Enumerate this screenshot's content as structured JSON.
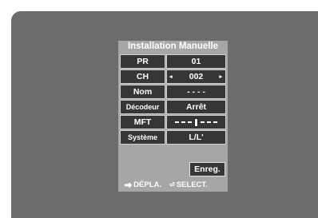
{
  "title": "Installation Manuelle",
  "rows": [
    {
      "label": "PR",
      "value": "01"
    },
    {
      "label": "CH",
      "value": "002"
    },
    {
      "label": "Nom",
      "value": "- - - -"
    },
    {
      "label": "Décodeur",
      "value": "Arrêt"
    },
    {
      "label": "MFT",
      "value": ""
    },
    {
      "label": "Système",
      "value": "L/L'"
    }
  ],
  "arrows": {
    "left": "◂",
    "right": "▸"
  },
  "save_label": "Enreg.",
  "hints": {
    "move_icon": "◂◈",
    "move_label": "DÉPLA.",
    "select_icon": "⏎",
    "select_label": "SELECT."
  },
  "mft_level": 0.5
}
